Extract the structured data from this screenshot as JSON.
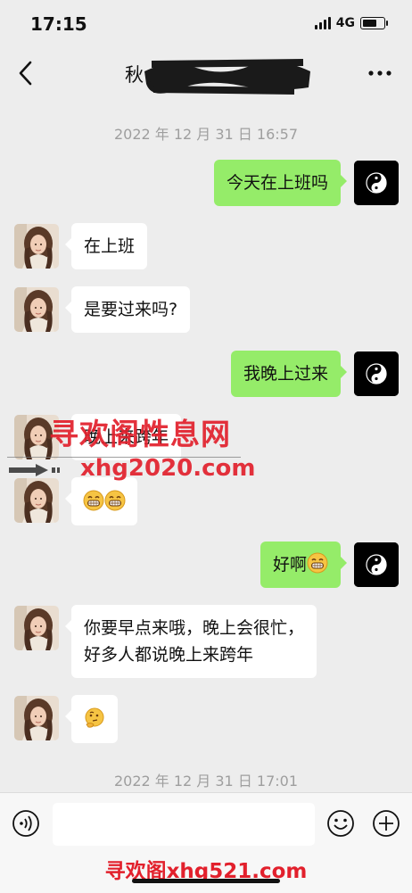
{
  "status": {
    "time": "17:15",
    "network": "4G",
    "battery_level": 0.75
  },
  "nav": {
    "title": "秋"
  },
  "timestamps": {
    "first": "2022 年 12 月 31 日 16:57",
    "second": "2022 年 12 月 31 日 17:01"
  },
  "messages": {
    "m1": {
      "text": "今天在上班吗"
    },
    "m2": {
      "text": "在上班"
    },
    "m3": {
      "text": "是要过来吗?"
    },
    "m4": {
      "text": "我晚上过来"
    },
    "m5": {
      "text": "晚上来跨年"
    },
    "m6": {
      "emojis": [
        "grinning-face-icon",
        "grinning-face-icon"
      ]
    },
    "m7": {
      "text": "好啊"
    },
    "m8": {
      "line1": "你要早点来哦，晚上会很忙，",
      "line2": "好多人都说晚上来跨年"
    },
    "m9": {
      "emojis": [
        "thinking-face-icon"
      ]
    }
  },
  "watermark": {
    "site_name": "寻欢阁性息网",
    "site_url": "xhg2020.com",
    "bottom": "寻欢阁xhg521.com"
  },
  "input": {
    "placeholder": ""
  },
  "colors": {
    "sent_bubble": "#95ec69",
    "received_bubble": "#ffffff",
    "background": "#ededed",
    "watermark": "#e2202c"
  }
}
